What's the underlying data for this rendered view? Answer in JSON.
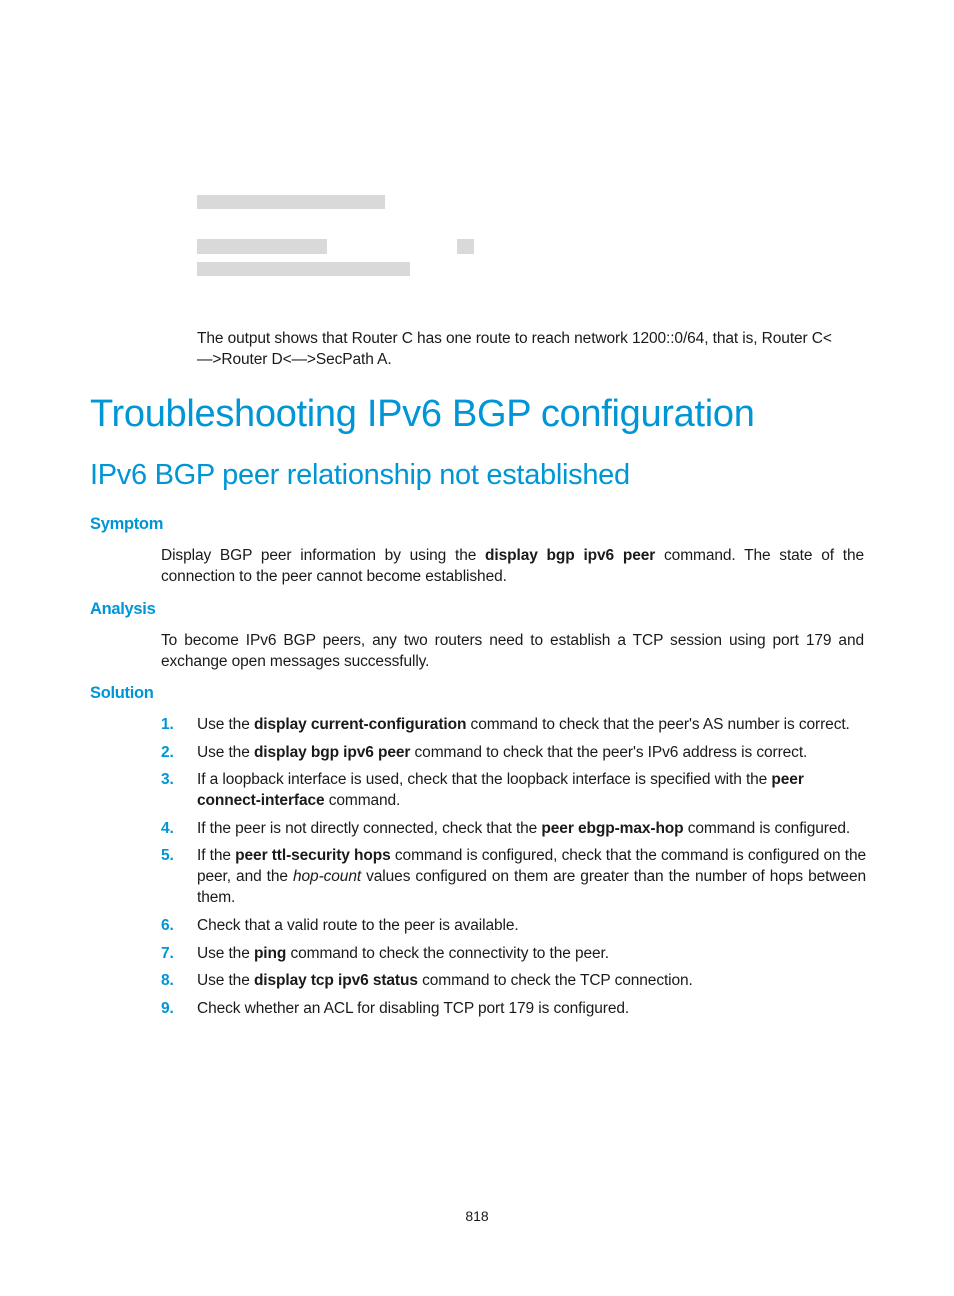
{
  "intro": {
    "text": "The output shows that Router C has one route to reach network 1200::0/64, that is, Router C<—>Router D<—>SecPath A."
  },
  "title": "Troubleshooting IPv6 BGP configuration",
  "subtitle": "IPv6 BGP peer relationship not established",
  "symptom": {
    "heading": "Symptom",
    "pre": "Display BGP peer information by using the ",
    "cmd": "display bgp ipv6 peer",
    "post": " command. The state of the connection to the peer cannot become established."
  },
  "analysis": {
    "heading": "Analysis",
    "text": "To become IPv6 BGP peers, any two routers need to establish a TCP session using port 179 and exchange open messages successfully."
  },
  "solution": {
    "heading": "Solution",
    "steps": [
      {
        "num": "1.",
        "pre": "Use the ",
        "cmd": "display current-configuration",
        "post": " command to check that the peer's AS number is correct."
      },
      {
        "num": "2.",
        "pre": "Use the ",
        "cmd": "display bgp ipv6 peer",
        "post": " command to check that the peer's IPv6 address is correct."
      },
      {
        "num": "3.",
        "pre": "If a loopback interface is used, check that the loopback interface is specified with the ",
        "cmd": "peer connect-interface",
        "post": " command."
      },
      {
        "num": "4.",
        "pre": "If the peer is not directly connected, check that the ",
        "cmd": "peer ebgp-max-hop",
        "post": " command is configured."
      },
      {
        "num": "5.",
        "pre": "If the ",
        "cmd": "peer ttl-security hops",
        "mid": " command is configured, check that the command is configured on the peer, and the ",
        "em": "hop-count",
        "post": " values configured on them are greater than the number of hops between them."
      },
      {
        "num": "6.",
        "pre": "Check that a valid route to the peer is available."
      },
      {
        "num": "7.",
        "pre": "Use the ",
        "cmd": "ping",
        "post": " command to check the connectivity to the peer."
      },
      {
        "num": "8.",
        "pre": "Use the ",
        "cmd": "display tcp ipv6 status",
        "post": " command to check the TCP connection."
      },
      {
        "num": "9.",
        "pre": "Check whether an ACL for disabling TCP port 179 is configured."
      }
    ]
  },
  "page_number": "818",
  "colors": {
    "heading": "#0096d6",
    "body_text": "#1a1a1a",
    "redaction": "#d9d9d9"
  }
}
